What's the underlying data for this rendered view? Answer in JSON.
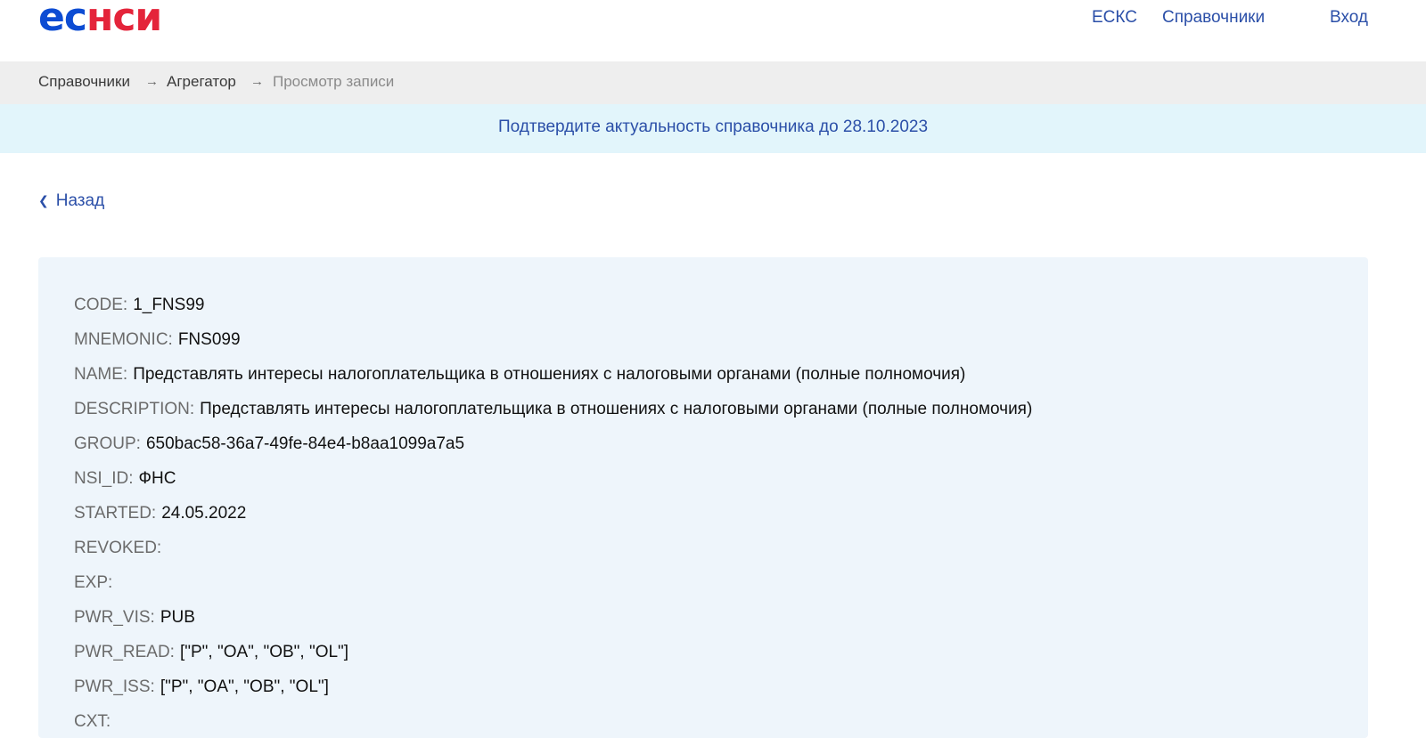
{
  "header": {
    "logo_part1": "ес",
    "logo_part2": "нси",
    "nav": {
      "eskc": "ЕСКС",
      "directories": "Справочники",
      "login": "Вход"
    }
  },
  "breadcrumb": {
    "items": [
      "Справочники",
      "Агрегатор",
      "Просмотр записи"
    ],
    "separator": "→"
  },
  "notice": {
    "text": "Подтвердите актуальность справочника до 28.10.2023"
  },
  "back": {
    "label": "Назад"
  },
  "record": {
    "fields": [
      {
        "key": "CODE:",
        "value": "1_FNS99"
      },
      {
        "key": "MNEMONIC:",
        "value": "FNS099"
      },
      {
        "key": "NAME:",
        "value": "Представлять интересы налогоплательщика в отношениях с налоговыми органами (полные полномочия)"
      },
      {
        "key": "DESCRIPTION:",
        "value": "Представлять интересы налогоплательщика в отношениях с налоговыми органами (полные полномочия)"
      },
      {
        "key": "GROUP:",
        "value": "650bac58-36a7-49fe-84e4-b8aa1099a7a5"
      },
      {
        "key": "NSI_ID:",
        "value": "ФНС"
      },
      {
        "key": "STARTED:",
        "value": "24.05.2022"
      },
      {
        "key": "REVOKED:",
        "value": ""
      },
      {
        "key": "EXP:",
        "value": ""
      },
      {
        "key": "PWR_VIS:",
        "value": "PUB"
      },
      {
        "key": "PWR_READ:",
        "value": "[\"P\", \"OA\", \"OB\", \"OL\"]"
      },
      {
        "key": "PWR_ISS:",
        "value": "[\"P\", \"OA\", \"OB\", \"OL\"]"
      },
      {
        "key": "CXT:",
        "value": ""
      }
    ]
  },
  "colors": {
    "brand_blue": "#0d4cd3",
    "brand_red": "#e4243a",
    "link": "#2b4fa8",
    "notice_bg": "#e2f5fb",
    "card_bg": "#eef5fb",
    "breadcrumb_bg": "#eeeeee"
  }
}
